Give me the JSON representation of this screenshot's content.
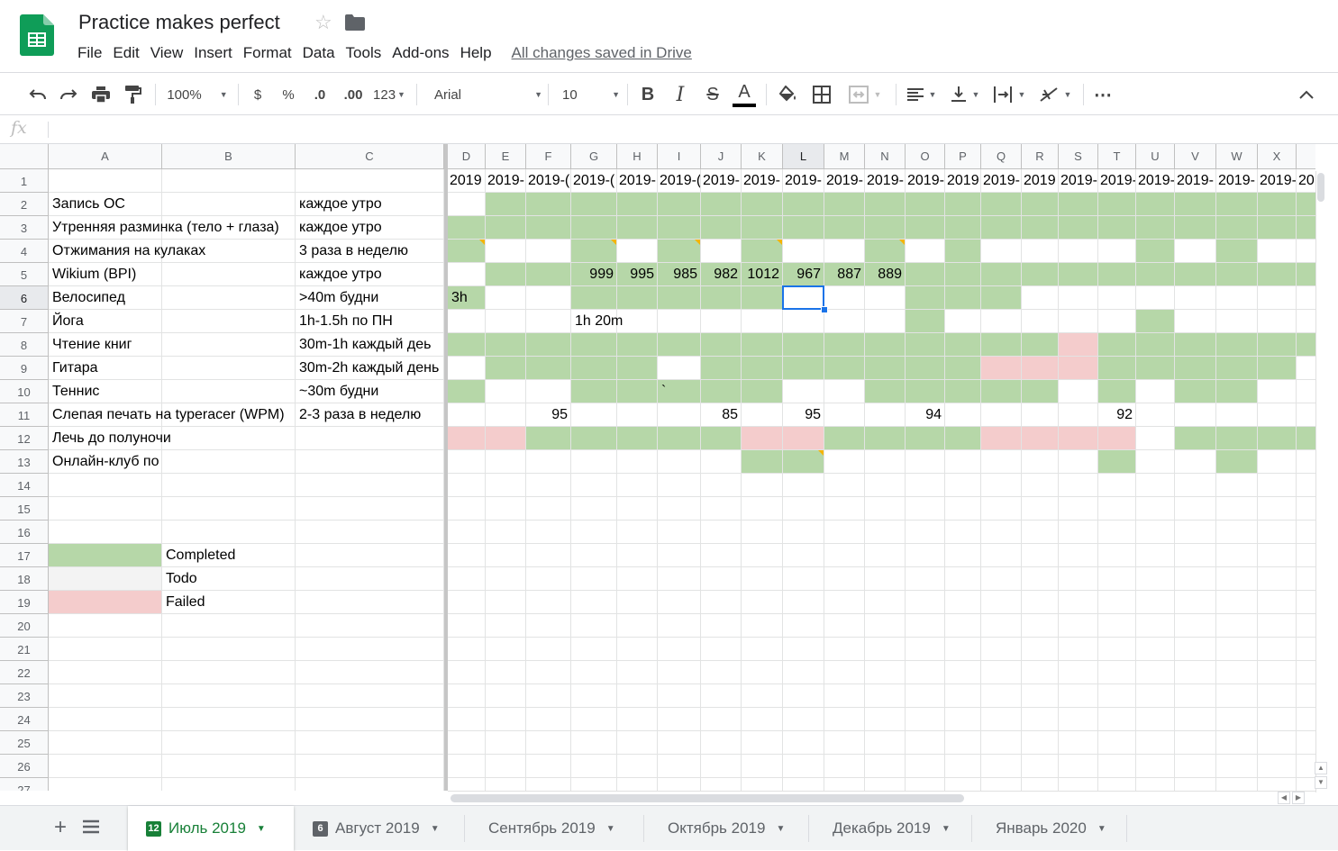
{
  "doc": {
    "title": "Practice makes perfect",
    "save_status": "All changes saved in Drive"
  },
  "menu": [
    "File",
    "Edit",
    "View",
    "Insert",
    "Format",
    "Data",
    "Tools",
    "Add-ons",
    "Help"
  ],
  "toolbar": {
    "zoom": "100%",
    "currency": "$",
    "percent": "%",
    "decrease_decimal": ".0",
    "increase_decimal": ".00",
    "more_formats": "123",
    "font": "Arial",
    "font_size": "10",
    "bold": "B",
    "italic": "I",
    "strike": "S",
    "text_color": "A",
    "more": "⋯"
  },
  "formula_bar": {
    "fx": "fx",
    "value": ""
  },
  "icons": {
    "undo": "undo-icon",
    "redo": "redo-icon",
    "print": "print-icon",
    "paint_format": "paint-format-icon",
    "fill": "fill-color-icon",
    "borders": "borders-icon",
    "merge": "merge-cells-icon",
    "h_align": "horizontal-align-icon",
    "v_align": "vertical-align-icon",
    "wrap": "text-wrapping-icon",
    "rotate": "text-rotation-icon",
    "collapse": "collapse-toolbar-icon"
  },
  "colors": {
    "completed": "#b6d7a8",
    "failed": "#f4cccc",
    "todo": "#ffffff",
    "accent": "#188038",
    "selection": "#1a73e8"
  },
  "grid": {
    "columns": [
      "A",
      "B",
      "C",
      "D",
      "E",
      "F",
      "G",
      "H",
      "I",
      "J",
      "K",
      "L",
      "M",
      "N",
      "O",
      "P",
      "Q",
      "R",
      "S",
      "T",
      "U",
      "V",
      "W",
      "X"
    ],
    "selected_column": "L",
    "selected_row": 6,
    "row_numbers": [
      1,
      2,
      3,
      4,
      5,
      6,
      7,
      8,
      9,
      10,
      11,
      12,
      13,
      14,
      15,
      16,
      17,
      18,
      19,
      20,
      21,
      22,
      23,
      24,
      25,
      26,
      27
    ],
    "date_headers": [
      "2019",
      "2019-",
      "2019-(",
      "2019-(",
      "2019-",
      "2019-(",
      "2019-",
      "2019-",
      "2019-",
      "2019-",
      "2019-",
      "2019-",
      "2019",
      "2019-",
      "2019",
      "2019-",
      "2019-",
      "2019-",
      "2019-",
      "2019-",
      "2019-",
      "20"
    ],
    "habits": [
      {
        "name": "Запись ОС",
        "schedule": "каждое утро"
      },
      {
        "name": "Утренняя разминка (тело + глаза)",
        "schedule": "каждое утро"
      },
      {
        "name": "Отжимания на кулаках",
        "schedule": "3 раза в неделю"
      },
      {
        "name": "Wikium (BPI)",
        "schedule": "каждое утро"
      },
      {
        "name": "Велосипед",
        "schedule": ">40m будни"
      },
      {
        "name": "Йога",
        "schedule": "1h-1.5h по ПН"
      },
      {
        "name": "Чтение книг",
        "schedule": "30m-1h каждый деь"
      },
      {
        "name": "Гитара",
        "schedule": "30m-2h каждый день"
      },
      {
        "name": "Теннис",
        "schedule": "~30m будни"
      },
      {
        "name": "Слепая печать на typeracer (WPM)",
        "schedule": "2-3 раза в неделю"
      },
      {
        "name": "Лечь до полуночи",
        "schedule": ""
      },
      {
        "name": "Онлайн-клуб по",
        "schedule": ""
      }
    ],
    "status_rows": [
      "wgggggggggggggggggggggg",
      "ggggggggggggggggggggggg",
      "gwwgwgwgwwgwgwwwwgwgw",
      "wggggggggggggggggggggggg",
      "gwwgggggwwwgggwwwwwwwww",
      "wwwwwwwwwwwgwwwwwgwwwww",
      "gggggggggggggggpggggggpg",
      "wggggwgggggggpppggggg",
      "gwwgggggwwgggggwgwgg",
      "wwwwwwwwwwwwwwwwwwwwwww",
      "ppgggggppggggpppp ggggpg",
      "wwwwwwwggwwwwwwwgwwgww"
    ],
    "cell_values": [
      {
        "row": 5,
        "col": "G",
        "value": "999"
      },
      {
        "row": 5,
        "col": "H",
        "value": "995"
      },
      {
        "row": 5,
        "col": "I",
        "value": "985"
      },
      {
        "row": 5,
        "col": "J",
        "value": "982"
      },
      {
        "row": 5,
        "col": "K",
        "value": "1012"
      },
      {
        "row": 5,
        "col": "L",
        "value": "967"
      },
      {
        "row": 5,
        "col": "M",
        "value": "887"
      },
      {
        "row": 5,
        "col": "N",
        "value": "889"
      },
      {
        "row": 6,
        "col": "D",
        "value": "3h"
      },
      {
        "row": 7,
        "col": "G",
        "value": "1h 20m"
      },
      {
        "row": 10,
        "col": "I",
        "value": "`"
      },
      {
        "row": 11,
        "col": "F",
        "value": "95"
      },
      {
        "row": 11,
        "col": "J",
        "value": "85"
      },
      {
        "row": 11,
        "col": "L",
        "value": "95"
      },
      {
        "row": 11,
        "col": "O",
        "value": "94"
      },
      {
        "row": 11,
        "col": "T",
        "value": "92"
      }
    ],
    "legend": [
      {
        "label": "Completed",
        "color": "#b6d7a8"
      },
      {
        "label": "Todo",
        "color": "#f3f3f3"
      },
      {
        "label": "Failed",
        "color": "#f4cccc"
      }
    ]
  },
  "tabs": [
    {
      "label": "Июль 2019",
      "badge": "12",
      "active": true
    },
    {
      "label": "Август 2019",
      "badge": "6",
      "active": false
    },
    {
      "label": "Сентябрь 2019",
      "badge": "",
      "active": false
    },
    {
      "label": "Октябрь 2019",
      "badge": "",
      "active": false
    },
    {
      "label": "Декабрь 2019",
      "badge": "",
      "active": false
    },
    {
      "label": "Январь 2020",
      "badge": "",
      "active": false
    }
  ]
}
